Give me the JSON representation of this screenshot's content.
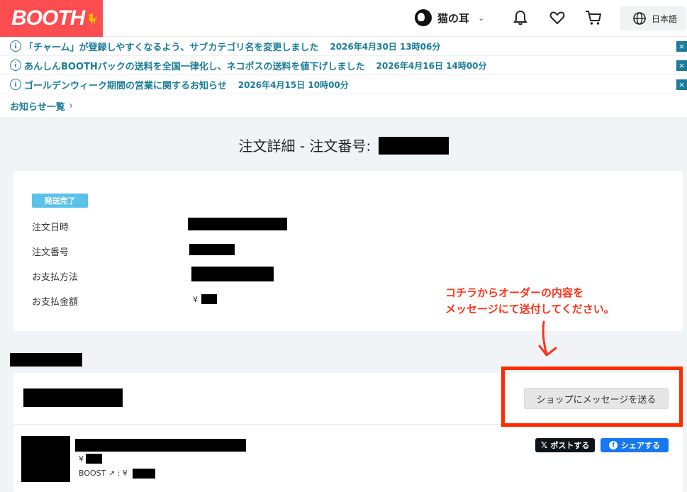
{
  "header": {
    "logo": "BOOTH",
    "username": "猫の耳",
    "language": "日本語"
  },
  "notices": [
    {
      "text": "「チャーム」が登録しやすくなるよう、サブカテゴリ名を変更しました",
      "date": "2026年4月30日 13時06分"
    },
    {
      "text": "あんしんBOOTHパックの送料を全国一律化し、ネコポスの送料を値下げしました",
      "date": "2026年4月16日 14時00分"
    },
    {
      "text": "ゴールデンウィーク期間の営業に関するお知らせ",
      "date": "2026年4月15日 10時00分"
    }
  ],
  "notice_info_glyph": "i",
  "notice_close_glyph": "×",
  "notice_all": "お知らせ一覧",
  "page_title": "注文詳細 - 注文番号:",
  "order": {
    "status": "発送完了",
    "labels": {
      "date": "注文日時",
      "number": "注文番号",
      "payment": "お支払方法",
      "amount": "お支払金額"
    },
    "yen": "¥"
  },
  "annotation": {
    "line1": "コチラからオーダーの内容を",
    "line2": "メッセージにて送付してください。"
  },
  "shop": {
    "message_button": "ショップにメッセージを送る"
  },
  "item": {
    "price_yen": "¥",
    "boost_label": "BOOST ↗ : ¥",
    "share_x": "ポストする",
    "share_fb": "シェアする"
  },
  "colors": {
    "brand": "#fc4d50",
    "notice": "#1a7c9a",
    "badge": "#5cc1e8",
    "annotation": "#ff3319",
    "x": "#0f1419",
    "facebook": "#1877f2"
  }
}
